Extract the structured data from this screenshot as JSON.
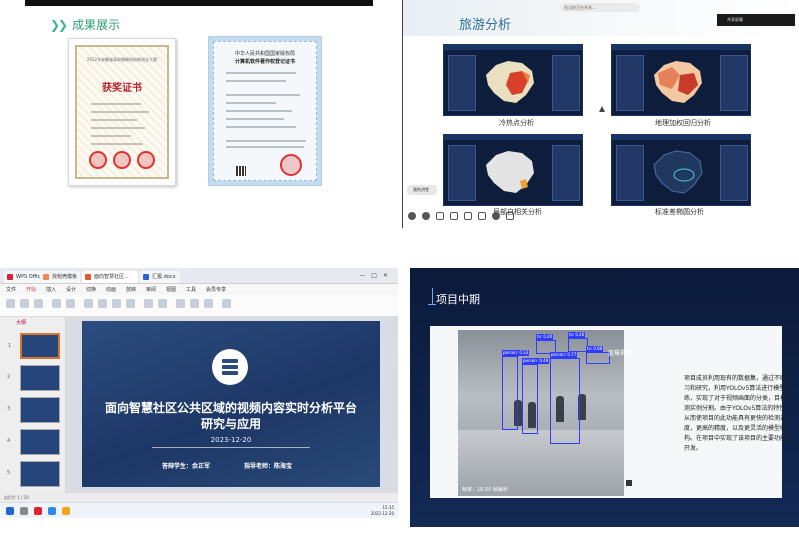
{
  "achievements": {
    "section_title": "成果展示",
    "award_certificate": {
      "year_line": "2022年安徽省高校物联网创新创业大赛",
      "title": "获奖证书"
    },
    "software_certificate": {
      "issuer": "中华人民共和国国家版权局",
      "title": "计算机软件著作权登记证书"
    }
  },
  "tourism": {
    "page_title": "旅游分析",
    "notice": "您当前正在共享...",
    "share_button": "共享屏幕",
    "captions": [
      "冷热点分析",
      "地理加权回归分析",
      "局部自相关分析",
      "标准差椭圆分析"
    ],
    "meeting_tag": "我的讲堂"
  },
  "presentation": {
    "tabs": [
      "WPS Office",
      "找稻壳模板",
      "面向智慧社区...",
      "汇报.docx"
    ],
    "menus": [
      "文件",
      "开始",
      "插入",
      "设计",
      "切换",
      "动画",
      "放映",
      "审阅",
      "视图",
      "工具",
      "会员专享"
    ],
    "panel_label": "大纲",
    "slide_numbers": [
      "1",
      "2",
      "3",
      "4",
      "5"
    ],
    "slide": {
      "title_line1": "面向智慧社区公共区域的视频内容实时分析平台",
      "title_line2": "研究与应用",
      "date": "2023-12-20",
      "student": "答辩学生：余正军",
      "advisor": "指导老师：陈海宝"
    },
    "status_text": "幻灯片 1 / 10",
    "clock_time": "15:35",
    "clock_date": "2022-12-20"
  },
  "midterm": {
    "title": "项目中期",
    "detections": [
      {
        "label": "tv: 0.40"
      },
      {
        "label": "tv: 0.46"
      },
      {
        "label": "person: 0.33"
      },
      {
        "label": "person: 0.49"
      },
      {
        "label": "person: 0.77"
      },
      {
        "label": "tv: 0.88"
      }
    ],
    "video_logo": "蓝莓视频",
    "fps_text": "帧率：18.00 帧每秒",
    "description": "项目成员利用现有的数据集，通过不断学习和研究，利用YOLOv5算法进行模型训练，实现了对于视频画面的分类，目标检测实例分割。由于YOLOv5算法的特性，从而使项目的此功能具有更快的检测速度，更高的精度，以及更灵活的模型结构。在项目中实现了该项目的主要功能的开发。"
  },
  "colors": {
    "section_green": "#2f9c73",
    "title_blue": "#2a6f9e",
    "slide_blue": "#1d3766",
    "detect_blue": "#2f3cff",
    "stamp_red": "#d33333"
  }
}
